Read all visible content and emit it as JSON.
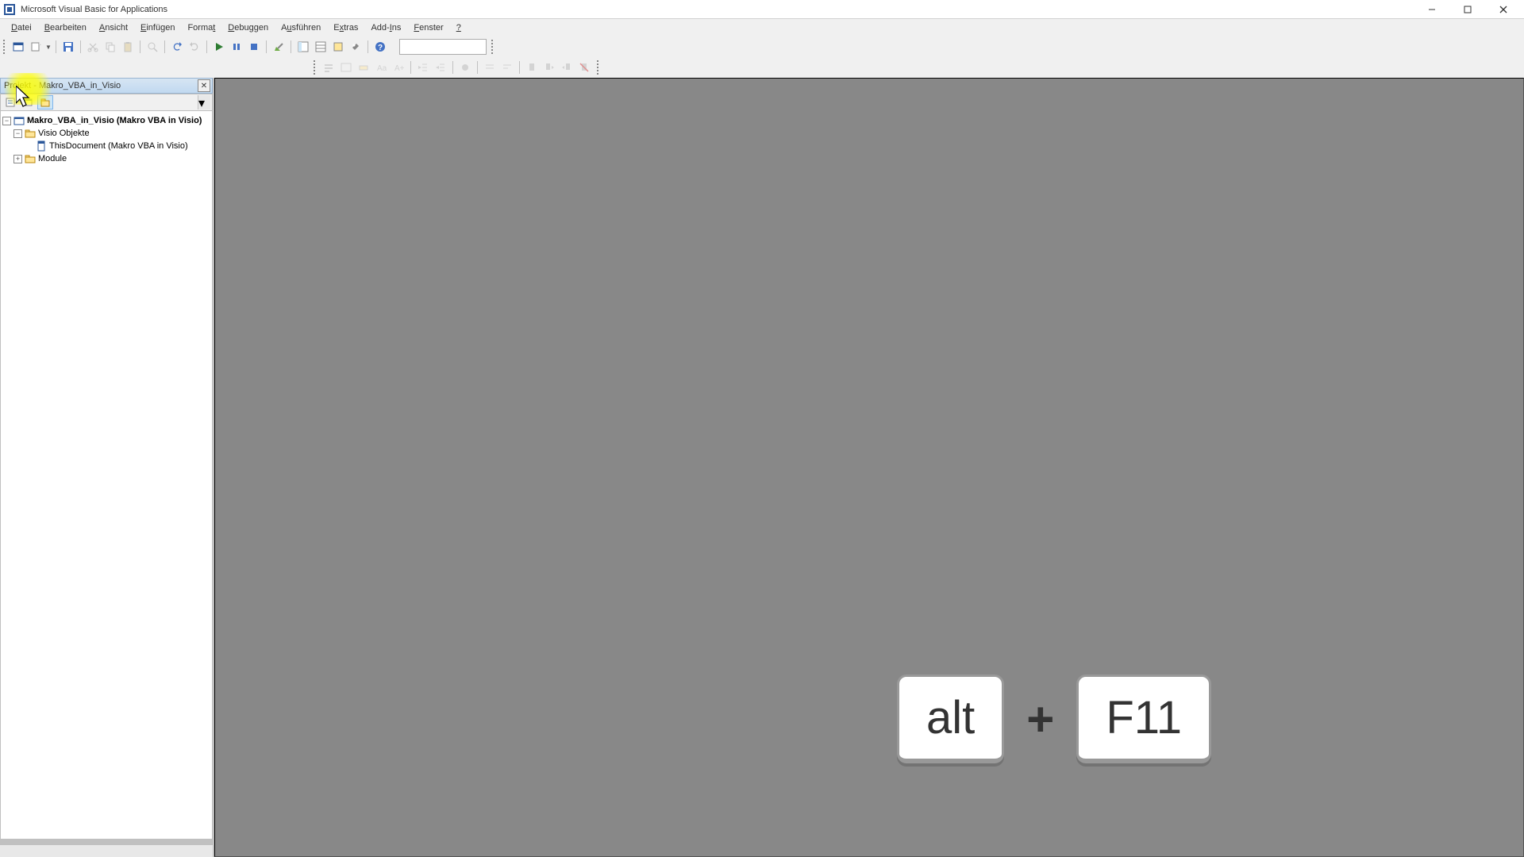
{
  "titlebar": {
    "title": "Microsoft Visual Basic for Applications"
  },
  "menubar": {
    "items": [
      {
        "label": "Datei",
        "key": "D"
      },
      {
        "label": "Bearbeiten",
        "key": "B"
      },
      {
        "label": "Ansicht",
        "key": "A"
      },
      {
        "label": "Einfügen",
        "key": "E"
      },
      {
        "label": "Format",
        "key": "F"
      },
      {
        "label": "Debuggen",
        "key": "D"
      },
      {
        "label": "Ausführen",
        "key": "A"
      },
      {
        "label": "Extras",
        "key": "E"
      },
      {
        "label": "Add-Ins",
        "key": "A"
      },
      {
        "label": "Fenster",
        "key": "F"
      },
      {
        "label": "?",
        "key": "?"
      }
    ]
  },
  "project_panel": {
    "title": "Projekt - Makro_VBA_in_Visio"
  },
  "tree": {
    "root": "Makro_VBA_in_Visio (Makro VBA in Visio)",
    "folder1": "Visio Objekte",
    "doc": "ThisDocument (Makro VBA in Visio)",
    "folder2": "Module"
  },
  "keys": {
    "k1": "alt",
    "plus": "+",
    "k2": "F11"
  }
}
